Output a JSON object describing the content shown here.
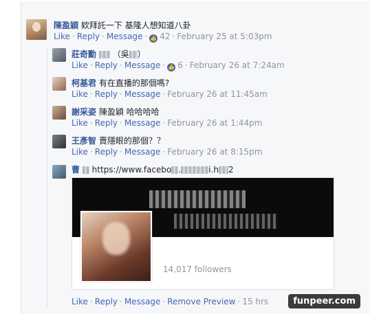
{
  "main_comment": {
    "author": "陳盈穎",
    "text": "欸拜託一下 基隆人想知道八卦",
    "actions": {
      "like": "Like",
      "reply": "Reply",
      "message": "Message",
      "reactions": "42",
      "timestamp": "February 25 at 5:03pm"
    }
  },
  "replies": [
    {
      "author": "莊奇勳",
      "text": "（吳",
      "text_end": "）",
      "actions": {
        "like": "Like",
        "reply": "Reply",
        "message": "Message",
        "reactions": "6",
        "timestamp": "February 26 at 7:24am"
      }
    },
    {
      "author": "柯基君",
      "text": "有在直播的那個嗎?",
      "actions": {
        "like": "Like",
        "reply": "Reply",
        "message": "Message",
        "timestamp": "February 26 at 11:45am"
      }
    },
    {
      "author": "謝采姿",
      "text": "陳盈穎 哈哈哈哈",
      "actions": {
        "like": "Like",
        "reply": "Reply",
        "message": "Message",
        "timestamp": "February 26 at 1:44pm"
      }
    },
    {
      "author": "王彥智",
      "text": "賣隱眼的那個？？",
      "actions": {
        "like": "Like",
        "reply": "Reply",
        "message": "Message",
        "timestamp": "February 26 at 8:15pm"
      }
    }
  ],
  "link_reply": {
    "author": "曹",
    "url_start": "https://www.facebo",
    "url_mid": ".",
    "url_end": "i.h",
    "url_tail": "2",
    "preview": {
      "followers": "14,017 followers"
    },
    "actions": {
      "like": "Like",
      "reply": "Reply",
      "message": "Message",
      "remove": "Remove Preview",
      "timestamp": "15 hrs"
    }
  },
  "watermark": "funpeer.com",
  "colors": {
    "name": "#365899",
    "link": "#4267b2",
    "meta": "#90949c",
    "panel": "#f6f7f9"
  },
  "icons": {
    "like_badge": "thumbs-up-icon"
  }
}
